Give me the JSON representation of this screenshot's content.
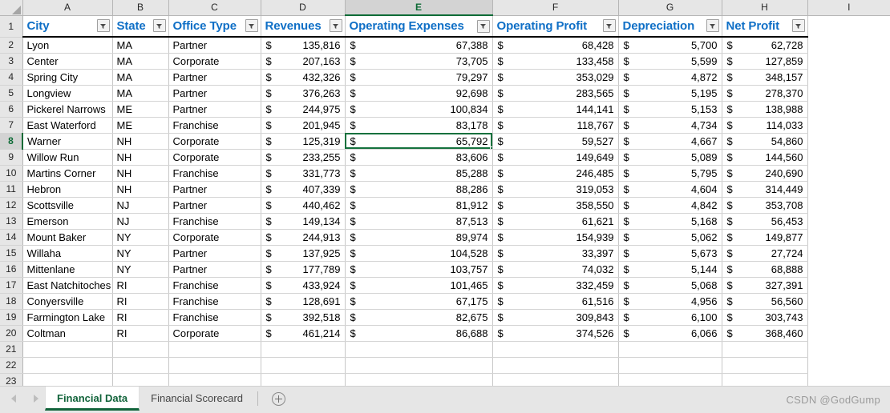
{
  "grid": {
    "column_letters": [
      "A",
      "B",
      "C",
      "D",
      "E",
      "F",
      "G",
      "H",
      "I"
    ],
    "selected_column": "E",
    "selected_row": 8,
    "selected_cell": "E8",
    "row_numbers": [
      1,
      2,
      3,
      4,
      5,
      6,
      7,
      8,
      9,
      10,
      11,
      12,
      13,
      14,
      15,
      16,
      17,
      18,
      19,
      20,
      21,
      22,
      23
    ],
    "empty_row_numbers": [
      21,
      22,
      23
    ]
  },
  "table": {
    "headers": [
      {
        "label": "City",
        "column": "A",
        "filter": "filter-arrow"
      },
      {
        "label": "State",
        "column": "B",
        "filter": "filter-arrow"
      },
      {
        "label": "Office Type",
        "column": "C",
        "filter": "filter-arrow"
      },
      {
        "label": "Revenues",
        "column": "D",
        "filter": "filter-arrow"
      },
      {
        "label": "Operating Expenses",
        "column": "E",
        "filter": "filter-arrow"
      },
      {
        "label": "Operating Profit",
        "column": "F",
        "filter": "filter-arrow"
      },
      {
        "label": "Depreciation",
        "column": "G",
        "filter": "filter-arrow"
      },
      {
        "label": "Net Profit",
        "column": "H",
        "filter": "filter-arrow"
      }
    ],
    "currency_symbol": "$",
    "rows": [
      {
        "row": 2,
        "city": "Lyon",
        "state": "MA",
        "office_type": "Partner",
        "revenues": "135,816",
        "operating_expenses": "67,388",
        "operating_profit": "68,428",
        "depreciation": "5,700",
        "net_profit": "62,728"
      },
      {
        "row": 3,
        "city": "Center",
        "state": "MA",
        "office_type": "Corporate",
        "revenues": "207,163",
        "operating_expenses": "73,705",
        "operating_profit": "133,458",
        "depreciation": "5,599",
        "net_profit": "127,859"
      },
      {
        "row": 4,
        "city": "Spring City",
        "state": "MA",
        "office_type": "Partner",
        "revenues": "432,326",
        "operating_expenses": "79,297",
        "operating_profit": "353,029",
        "depreciation": "4,872",
        "net_profit": "348,157"
      },
      {
        "row": 5,
        "city": "Longview",
        "state": "MA",
        "office_type": "Partner",
        "revenues": "376,263",
        "operating_expenses": "92,698",
        "operating_profit": "283,565",
        "depreciation": "5,195",
        "net_profit": "278,370"
      },
      {
        "row": 6,
        "city": "Pickerel Narrows",
        "state": "ME",
        "office_type": "Partner",
        "revenues": "244,975",
        "operating_expenses": "100,834",
        "operating_profit": "144,141",
        "depreciation": "5,153",
        "net_profit": "138,988"
      },
      {
        "row": 7,
        "city": "East Waterford",
        "state": "ME",
        "office_type": "Franchise",
        "revenues": "201,945",
        "operating_expenses": "83,178",
        "operating_profit": "118,767",
        "depreciation": "4,734",
        "net_profit": "114,033"
      },
      {
        "row": 8,
        "city": "Warner",
        "state": "NH",
        "office_type": "Corporate",
        "revenues": "125,319",
        "operating_expenses": "65,792",
        "operating_profit": "59,527",
        "depreciation": "4,667",
        "net_profit": "54,860"
      },
      {
        "row": 9,
        "city": "Willow Run",
        "state": "NH",
        "office_type": "Corporate",
        "revenues": "233,255",
        "operating_expenses": "83,606",
        "operating_profit": "149,649",
        "depreciation": "5,089",
        "net_profit": "144,560"
      },
      {
        "row": 10,
        "city": "Martins Corner",
        "state": "NH",
        "office_type": "Franchise",
        "revenues": "331,773",
        "operating_expenses": "85,288",
        "operating_profit": "246,485",
        "depreciation": "5,795",
        "net_profit": "240,690"
      },
      {
        "row": 11,
        "city": "Hebron",
        "state": "NH",
        "office_type": "Partner",
        "revenues": "407,339",
        "operating_expenses": "88,286",
        "operating_profit": "319,053",
        "depreciation": "4,604",
        "net_profit": "314,449"
      },
      {
        "row": 12,
        "city": "Scottsville",
        "state": "NJ",
        "office_type": "Partner",
        "revenues": "440,462",
        "operating_expenses": "81,912",
        "operating_profit": "358,550",
        "depreciation": "4,842",
        "net_profit": "353,708"
      },
      {
        "row": 13,
        "city": "Emerson",
        "state": "NJ",
        "office_type": "Franchise",
        "revenues": "149,134",
        "operating_expenses": "87,513",
        "operating_profit": "61,621",
        "depreciation": "5,168",
        "net_profit": "56,453"
      },
      {
        "row": 14,
        "city": "Mount Baker",
        "state": "NY",
        "office_type": "Corporate",
        "revenues": "244,913",
        "operating_expenses": "89,974",
        "operating_profit": "154,939",
        "depreciation": "5,062",
        "net_profit": "149,877"
      },
      {
        "row": 15,
        "city": "Willaha",
        "state": "NY",
        "office_type": "Partner",
        "revenues": "137,925",
        "operating_expenses": "104,528",
        "operating_profit": "33,397",
        "depreciation": "5,673",
        "net_profit": "27,724"
      },
      {
        "row": 16,
        "city": "Mittenlane",
        "state": "NY",
        "office_type": "Partner",
        "revenues": "177,789",
        "operating_expenses": "103,757",
        "operating_profit": "74,032",
        "depreciation": "5,144",
        "net_profit": "68,888"
      },
      {
        "row": 17,
        "city": "East Natchitoches",
        "state": "RI",
        "office_type": "Franchise",
        "revenues": "433,924",
        "operating_expenses": "101,465",
        "operating_profit": "332,459",
        "depreciation": "5,068",
        "net_profit": "327,391"
      },
      {
        "row": 18,
        "city": "Conyersville",
        "state": "RI",
        "office_type": "Franchise",
        "revenues": "128,691",
        "operating_expenses": "67,175",
        "operating_profit": "61,516",
        "depreciation": "4,956",
        "net_profit": "56,560"
      },
      {
        "row": 19,
        "city": "Farmington Lake",
        "state": "RI",
        "office_type": "Franchise",
        "revenues": "392,518",
        "operating_expenses": "82,675",
        "operating_profit": "309,843",
        "depreciation": "6,100",
        "net_profit": "303,743"
      },
      {
        "row": 20,
        "city": "Coltman",
        "state": "RI",
        "office_type": "Corporate",
        "revenues": "461,214",
        "operating_expenses": "86,688",
        "operating_profit": "374,526",
        "depreciation": "6,066",
        "net_profit": "368,460"
      }
    ]
  },
  "tabbar": {
    "prev_icon": "left-arrow-icon",
    "next_icon": "right-arrow-icon",
    "sheets": [
      {
        "name": "Financial Data",
        "active": true
      },
      {
        "name": "Financial Scorecard",
        "active": false
      }
    ],
    "add_sheet_icon": "plus-circle-icon",
    "watermark": "CSDN @GodGump"
  },
  "colors": {
    "header_text": "#0f6fc6",
    "selection_green": "#14713d",
    "tab_active_text": "#11633a",
    "gridline": "#d4d4d4"
  }
}
